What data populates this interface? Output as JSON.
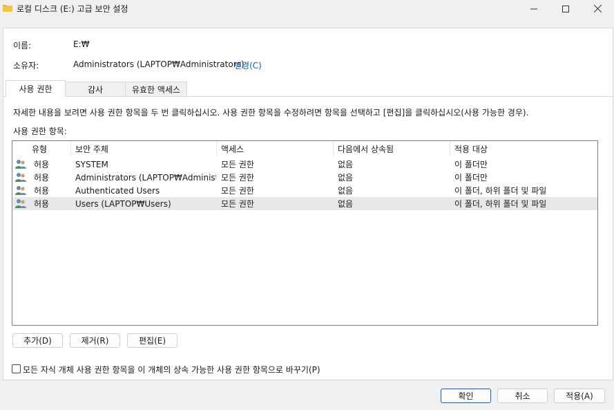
{
  "window": {
    "title": "로컬 디스크 (E:) 고급 보안 설정",
    "icon": "folder-icon"
  },
  "info": {
    "name_label": "이름:",
    "name_value": "E:₩",
    "owner_label": "소유자:",
    "owner_value": "Administrators (LAPTOP₩Administrators)",
    "change_link": "변경(C)"
  },
  "tabs": [
    {
      "label": "사용 권한",
      "active": true
    },
    {
      "label": "감사",
      "active": false
    },
    {
      "label": "유효한 액세스",
      "active": false
    }
  ],
  "description": "자세한 내용을 보려면 사용 권한 항목을 두 번 클릭하십시오. 사용 권한 항목을 수정하려면 항목을 선택하고 [편집]을 클릭하십시오(사용 가능한 경우).",
  "entries_label": "사용 권한 항목:",
  "columns": [
    "유형",
    "보안 주체",
    "액세스",
    "다음에서 상속됨",
    "적용 대상"
  ],
  "rows": [
    {
      "type": "허용",
      "principal": "SYSTEM",
      "access": "모든 권한",
      "inherited": "없음",
      "applies": "이 폴더만",
      "selected": false
    },
    {
      "type": "허용",
      "principal": "Administrators (LAPTOP₩Administr...",
      "access": "모든 권한",
      "inherited": "없음",
      "applies": "이 폴더만",
      "selected": false
    },
    {
      "type": "허용",
      "principal": "Authenticated Users",
      "access": "모든 권한",
      "inherited": "없음",
      "applies": "이 폴더, 하위 폴더 및 파일",
      "selected": false
    },
    {
      "type": "허용",
      "principal": "Users (LAPTOP₩Users)",
      "access": "모든 권한",
      "inherited": "없음",
      "applies": "이 폴더, 하위 폴더 및 파일",
      "selected": true
    }
  ],
  "buttons": {
    "add": "추가(D)",
    "remove": "제거(R)",
    "edit": "편집(E)",
    "ok": "확인",
    "cancel": "취소",
    "apply": "적용(A)"
  },
  "replace_checkbox": {
    "label": "모든 자식 개체 사용 권한 항목을 이 개체의 상속 가능한 사용 권한 항목으로 바꾸기(P)",
    "checked": false
  },
  "colors": {
    "link": "#0a5ebf",
    "selected_row": "#e8e8e8",
    "folder": "#f4c542"
  }
}
